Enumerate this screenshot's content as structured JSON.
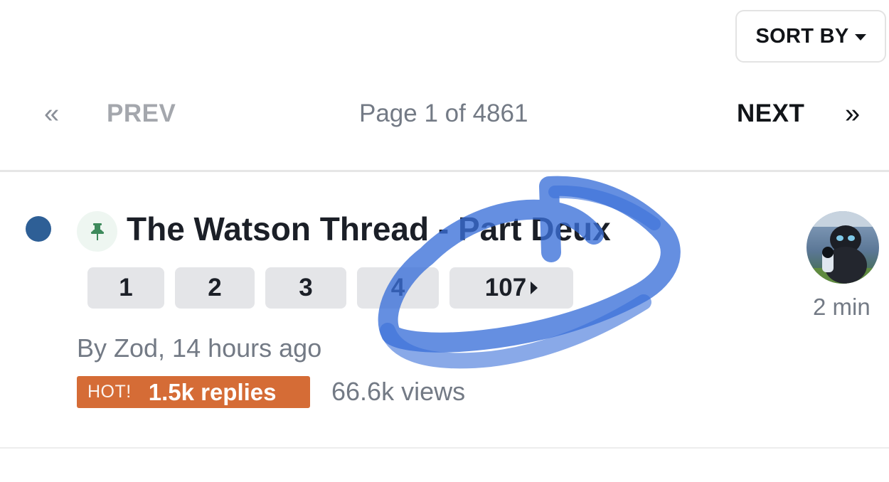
{
  "sort": {
    "label": "SORT BY"
  },
  "pagination": {
    "first_glyph": "«",
    "prev_label": "PREV",
    "info": "Page 1 of 4861",
    "next_label": "NEXT",
    "last_glyph": "»"
  },
  "topic": {
    "title": "The Watson Thread - Part Deux",
    "pages": [
      "1",
      "2",
      "3",
      "4",
      "107"
    ],
    "author_line": "By Zod, 14 hours ago",
    "hot_label": "HOT!",
    "replies": "1.5k replies",
    "views": "66.6k views",
    "last_activity": "2 min",
    "unread_color": "#2e5f96",
    "pin_icon": "pin-icon",
    "hot_color": "#d56c36"
  },
  "annotation": {
    "color": "#3a6fd8",
    "shape": "hand-drawn circle"
  }
}
